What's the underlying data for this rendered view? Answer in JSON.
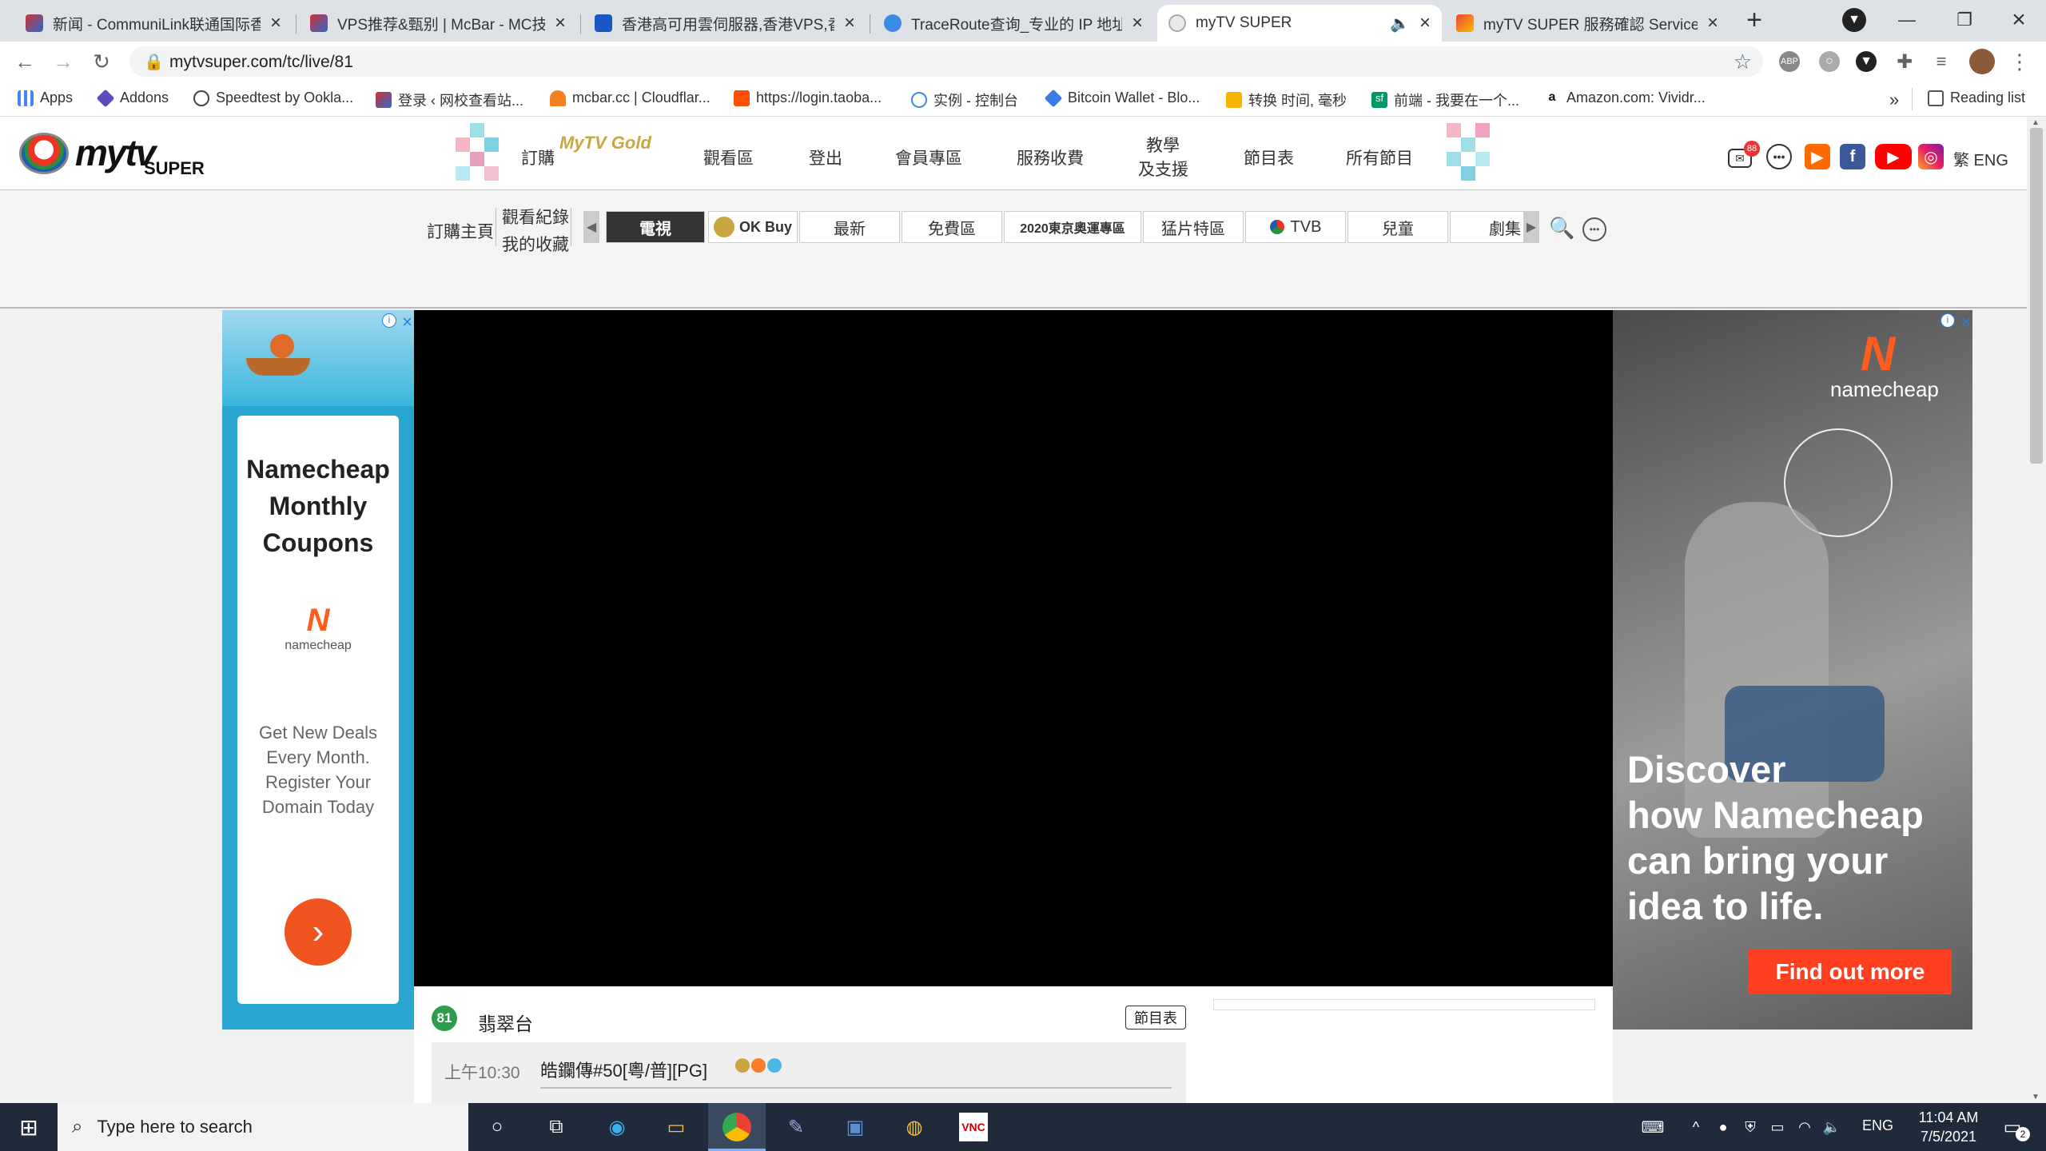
{
  "browser": {
    "tabs": [
      {
        "title": "新闻 - CommuniLink联通国际香港",
        "active": false
      },
      {
        "title": "VPS推荐&甄别 | McBar - MC技术",
        "active": false
      },
      {
        "title": "香港高可用雲伺服器,香港VPS,香港",
        "active": false
      },
      {
        "title": "TraceRoute查询_专业的 IP 地址库",
        "active": false
      },
      {
        "title": "myTV SUPER",
        "active": true
      },
      {
        "title": "myTV SUPER 服務確認 Service Co",
        "active": false
      }
    ],
    "url": "mytvsuper.com/tc/live/81",
    "bookmarks": [
      "Apps",
      "Addons",
      "Speedtest by Ookla...",
      "登录 ‹ 网校查看站...",
      "mcbar.cc | Cloudflar...",
      "https://login.taoba...",
      "实例 - 控制台",
      "Bitcoin Wallet - Blo...",
      "转换 时间, 毫秒",
      "前端 - 我要在一个...",
      "Amazon.com: Vividr..."
    ],
    "bookmarks_overflow": "»",
    "reading_list": "Reading list",
    "mail_badge": "88"
  },
  "site": {
    "logo": "mytv",
    "logo_sub": "SUPER",
    "gold_subscribe": "訂購",
    "gold_logo": "MyTV Gold",
    "menu": [
      "觀看區",
      "登出",
      "會員專區",
      "服務收費"
    ],
    "menu_support_1": "教學",
    "menu_support_2": "及支援",
    "menu_tail": [
      "節目表",
      "所有節目"
    ],
    "lang": "繁 ENG",
    "subnav": {
      "subscribe_home": "訂購主頁",
      "watch_history": "觀看紀錄",
      "favourites": "我的收藏",
      "tabs": [
        "電視",
        "OK Buy",
        "最新",
        "免費區",
        "2020東京奧運專區",
        "猛片特區",
        "TVB",
        "兒童",
        "劇集"
      ]
    },
    "channel": {
      "number": "81",
      "name": "翡翠台",
      "schedule_button": "節目表",
      "program_time": "上午10:30",
      "program_title": "皓鑭傳#50[粵/普][PG]"
    }
  },
  "ads": {
    "left": {
      "title_lines": [
        "Namecheap",
        "Monthly",
        "Coupons"
      ],
      "brand": "namecheap",
      "body_lines": [
        "Get New Deals",
        "Every Month.",
        "Register Your",
        "Domain Today"
      ]
    },
    "right": {
      "brand": "namecheap",
      "headline_lines": [
        "Discover",
        "how Namecheap",
        "can bring your",
        "idea to life."
      ],
      "cta": "Find out more"
    }
  },
  "taskbar": {
    "search_placeholder": "Type here to search",
    "lang": "ENG",
    "time": "11:04 AM",
    "date": "7/5/2021",
    "notif_count": "2"
  },
  "colors": {
    "namecheap_orange": "#ff5c1f",
    "ad_cyan": "#28a6d0",
    "channel_green": "#2d9d4a",
    "taskbar": "#1f2a3a"
  }
}
